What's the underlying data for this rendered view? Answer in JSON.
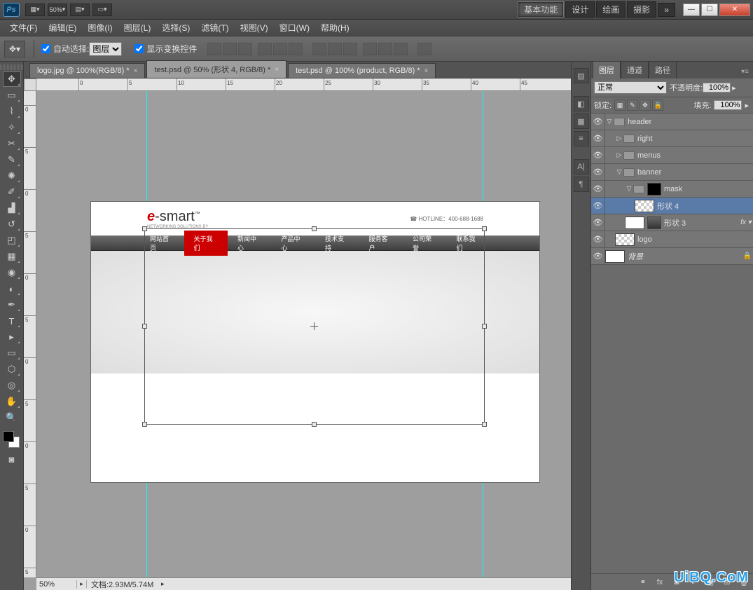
{
  "titlebar": {
    "logo": "Ps",
    "zoom": "50%",
    "workspaces": [
      "基本功能",
      "设计",
      "绘画",
      "摄影"
    ],
    "workspace_more": "»"
  },
  "menu": {
    "items": [
      "文件(F)",
      "编辑(E)",
      "图像(I)",
      "图层(L)",
      "选择(S)",
      "滤镜(T)",
      "视图(V)",
      "窗口(W)",
      "帮助(H)"
    ]
  },
  "options": {
    "auto_select_label": "自动选择:",
    "auto_select_dropdown": "图层",
    "show_transform_label": "显示变换控件"
  },
  "tabs": [
    {
      "label": "logo.jpg @ 100%(RGB/8) *"
    },
    {
      "label": "test.psd @ 50% (形状 4, RGB/8) *",
      "active": true
    },
    {
      "label": "test.psd @ 100% (product, RGB/8) *"
    }
  ],
  "ruler_h": [
    "0",
    "5",
    "10",
    "15",
    "20",
    "25",
    "30",
    "35",
    "40",
    "45"
  ],
  "ruler_v": [
    "0",
    "5",
    "0",
    "5",
    "0",
    "5",
    "0",
    "5",
    "0",
    "5",
    "0",
    "5"
  ],
  "artboard": {
    "logo_prefix": "e",
    "logo_rest": "-smart",
    "logo_tm": "™",
    "logo_sub": "NETWORKING SOLUTIONS BY",
    "hotline": "HOTLINE：400-688-1688",
    "nav": [
      "网站首页",
      "关于我们",
      "新闻中心",
      "产品中心",
      "技术支持",
      "服务客户",
      "公司荣誉",
      "联系我们"
    ],
    "nav_active_index": 1
  },
  "status": {
    "zoom": "50%",
    "doc": "文档:2.93M/5.74M"
  },
  "panels": {
    "tabs": [
      "图层",
      "通道",
      "路径"
    ],
    "blend_mode": "正常",
    "opacity_label": "不透明度:",
    "opacity_value": "100%",
    "lock_label": "锁定:",
    "fill_label": "填充:",
    "fill_value": "100%"
  },
  "layers": [
    {
      "type": "group",
      "name": "header",
      "depth": 0,
      "expanded": true
    },
    {
      "type": "group",
      "name": "right",
      "depth": 1,
      "expanded": false
    },
    {
      "type": "group",
      "name": "menus",
      "depth": 1,
      "expanded": false
    },
    {
      "type": "group",
      "name": "banner",
      "depth": 1,
      "expanded": true
    },
    {
      "type": "group",
      "name": "mask",
      "depth": 2,
      "expanded": true,
      "mask": true
    },
    {
      "type": "shape",
      "name": "形状 4",
      "depth": 3,
      "selected": true,
      "trans": true
    },
    {
      "type": "shape",
      "name": "形状 3",
      "depth": 2,
      "mask": true,
      "fx": true
    },
    {
      "type": "layer",
      "name": "logo",
      "depth": 1,
      "trans": true
    },
    {
      "type": "bg",
      "name": "背景",
      "depth": 0,
      "locked": true,
      "italic": true
    }
  ],
  "watermark": "UiBQ.CoM"
}
